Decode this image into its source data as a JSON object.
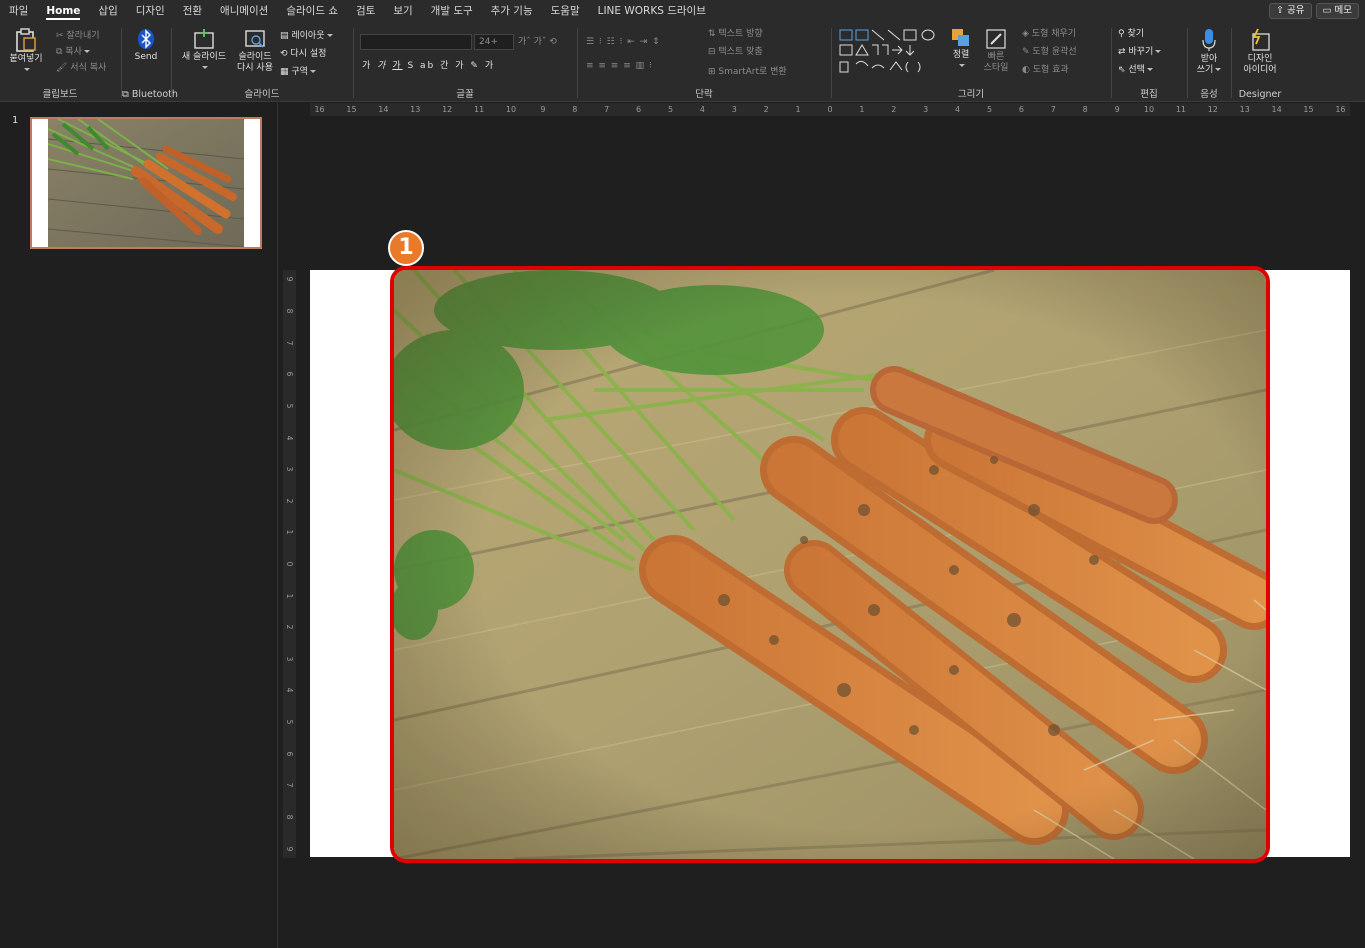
{
  "menu": {
    "tabs": [
      "파일",
      "Home",
      "삽입",
      "디자인",
      "전환",
      "애니메이션",
      "슬라이드 쇼",
      "검토",
      "보기",
      "개발 도구",
      "추가 기능",
      "도움말",
      "LINE WORKS 드라이브"
    ],
    "active": "Home",
    "share_label": "공유",
    "memo_label": "메모"
  },
  "ribbon": {
    "clipboard": {
      "label": "클립보드",
      "paste": "붙여넣기",
      "cut": "잘라내기",
      "copy": "복사",
      "format_painter": "서식 복사"
    },
    "bluetooth": {
      "label": "Bluetooth",
      "send": "Send"
    },
    "slides": {
      "label": "슬라이드",
      "new_slide": "새 슬라이드",
      "reuse_slide_1": "슬라이드",
      "reuse_slide_2": "다시 사용",
      "layout": "레이아웃",
      "reset": "다시 설정",
      "section": "구역"
    },
    "font": {
      "label": "글꼴",
      "size": "24+"
    },
    "paragraph": {
      "label": "단락",
      "text_direction": "텍스트 방향",
      "align_text": "텍스트 맞춤",
      "smartart": "SmartArt로 변환"
    },
    "drawing": {
      "label": "그리기",
      "arrange": "정렬",
      "quick_styles_1": "빠른",
      "quick_styles_2": "스타일",
      "shape_fill": "도형 채우기",
      "shape_outline": "도형 윤곽선",
      "shape_effects": "도형 효과"
    },
    "editing": {
      "label": "편집",
      "find": "찾기",
      "replace": "바꾸기",
      "select": "선택"
    },
    "voice": {
      "label": "음성",
      "dictate_1": "받아",
      "dictate_2": "쓰기"
    },
    "designer": {
      "label": "Designer",
      "ideas_1": "디자인",
      "ideas_2": "아이디어"
    }
  },
  "ruler": {
    "horizontal": [
      "16",
      "15",
      "14",
      "13",
      "12",
      "11",
      "10",
      "9",
      "8",
      "7",
      "6",
      "5",
      "4",
      "3",
      "2",
      "1",
      "0",
      "1",
      "2",
      "3",
      "4",
      "5",
      "6",
      "7",
      "8",
      "9",
      "10",
      "11",
      "12",
      "13",
      "14",
      "15",
      "16"
    ],
    "vertical": [
      "9",
      "8",
      "7",
      "6",
      "5",
      "4",
      "3",
      "2",
      "1",
      "0",
      "1",
      "2",
      "3",
      "4",
      "5",
      "6",
      "7",
      "8",
      "9"
    ]
  },
  "slides_panel": {
    "slide_number": "1"
  },
  "annotation": {
    "badge": "1"
  },
  "colors": {
    "highlight": "#e00000",
    "badge": "#e97a2a",
    "thumb_border": "#c17a62"
  }
}
